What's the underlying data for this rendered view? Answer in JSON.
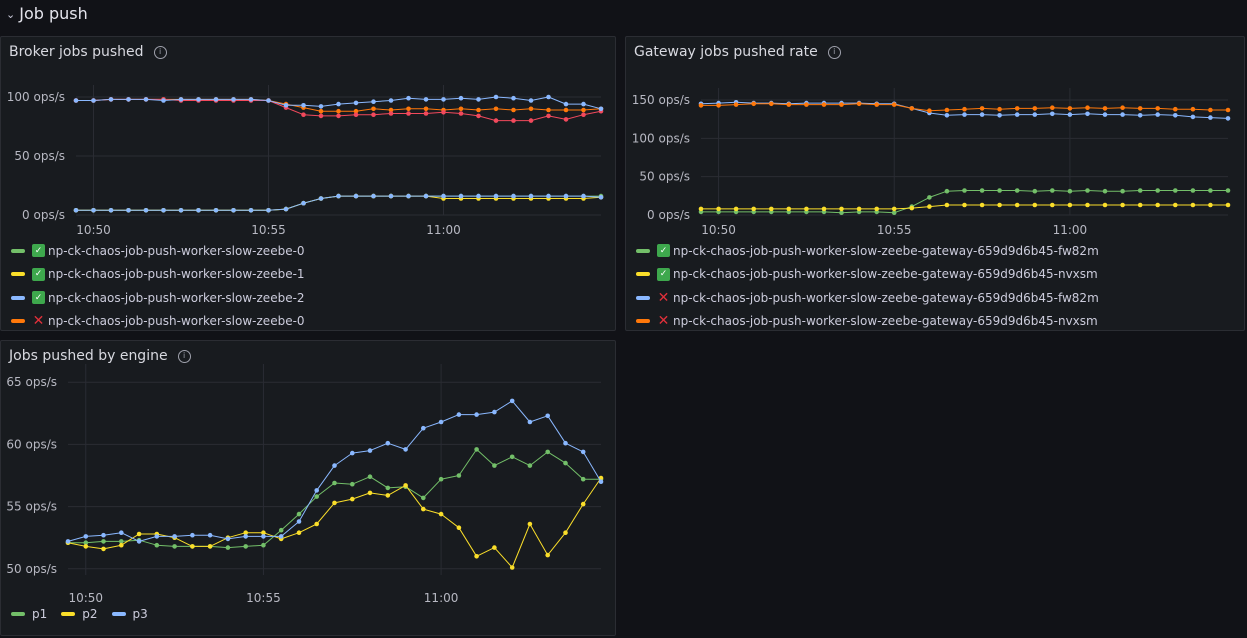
{
  "row": {
    "title": "Job push"
  },
  "panels": {
    "broker": {
      "title": "Broker jobs pushed",
      "legend": [
        {
          "status": "ok",
          "label": "np-ck-chaos-job-push-worker-slow-zeebe-0",
          "color": "#73bf69"
        },
        {
          "status": "ok",
          "label": "np-ck-chaos-job-push-worker-slow-zeebe-1",
          "color": "#fade2a"
        },
        {
          "status": "ok",
          "label": "np-ck-chaos-job-push-worker-slow-zeebe-2",
          "color": "#8ab8ff"
        },
        {
          "status": "bad",
          "label": "np-ck-chaos-job-push-worker-slow-zeebe-0",
          "color": "#ff780a"
        }
      ]
    },
    "gateway": {
      "title": "Gateway jobs pushed rate",
      "legend": [
        {
          "status": "ok",
          "label": "np-ck-chaos-job-push-worker-slow-zeebe-gateway-659d9d6b45-fw82m",
          "color": "#73bf69"
        },
        {
          "status": "ok",
          "label": "np-ck-chaos-job-push-worker-slow-zeebe-gateway-659d9d6b45-nvxsm",
          "color": "#fade2a"
        },
        {
          "status": "bad",
          "label": "np-ck-chaos-job-push-worker-slow-zeebe-gateway-659d9d6b45-fw82m",
          "color": "#8ab8ff"
        },
        {
          "status": "bad",
          "label": "np-ck-chaos-job-push-worker-slow-zeebe-gateway-659d9d6b45-nvxsm",
          "color": "#ff780a"
        }
      ]
    },
    "engine": {
      "title": "Jobs pushed by engine",
      "legend": [
        {
          "label": "p1",
          "color": "#73bf69"
        },
        {
          "label": "p2",
          "color": "#fade2a"
        },
        {
          "label": "p3",
          "color": "#8ab8ff"
        }
      ]
    }
  },
  "chart_data": [
    {
      "id": "broker",
      "type": "line",
      "title": "Broker jobs pushed",
      "unit": "ops/s",
      "xlabel": "",
      "ylabel": "",
      "x_ticks": [
        "10:50",
        "10:55",
        "11:00"
      ],
      "y_ticks": [
        "0 ops/s",
        "50 ops/s",
        "100 ops/s"
      ],
      "ylim": [
        0,
        100
      ],
      "grid": true,
      "legend_position": "bottom",
      "x": [
        "10:49:30",
        "10:50",
        "10:50:30",
        "10:51",
        "10:51:30",
        "10:52",
        "10:52:30",
        "10:53",
        "10:53:30",
        "10:54",
        "10:54:30",
        "10:55",
        "10:55:30",
        "10:56",
        "10:56:30",
        "10:57",
        "10:57:30",
        "10:58",
        "10:58:30",
        "10:59",
        "10:59:30",
        "11:00",
        "11:00:30",
        "11:01",
        "11:01:30",
        "11:02",
        "11:02:30",
        "11:03",
        "11:03:30",
        "11:04",
        "11:04:30"
      ],
      "series": [
        {
          "name": "np-ck-chaos-job-push-worker-slow-zeebe-0",
          "color": "#73bf69",
          "values": [
            4,
            4,
            4,
            4,
            4,
            4,
            4,
            4,
            4,
            4,
            4,
            4,
            5,
            10,
            14,
            16,
            16,
            16,
            16,
            16,
            16,
            16,
            16,
            16,
            16,
            16,
            16,
            16,
            16,
            16,
            16
          ]
        },
        {
          "name": "np-ck-chaos-job-push-worker-slow-zeebe-1",
          "color": "#fade2a",
          "values": [
            4,
            4,
            4,
            4,
            4,
            4,
            4,
            4,
            4,
            4,
            4,
            4,
            5,
            10,
            14,
            16,
            16,
            16,
            16,
            16,
            16,
            14,
            14,
            14,
            14,
            14,
            14,
            14,
            14,
            14,
            15
          ]
        },
        {
          "name": "np-ck-chaos-job-push-worker-slow-zeebe-2",
          "color": "#8ab8ff",
          "values": [
            4,
            4,
            4,
            4,
            4,
            4,
            4,
            4,
            4,
            4,
            4,
            4,
            5,
            10,
            14,
            16,
            16,
            16,
            16,
            16,
            16,
            16,
            16,
            16,
            16,
            16,
            16,
            16,
            16,
            16,
            15
          ]
        },
        {
          "name": "np-ck-chaos-job-push-worker-slow-zeebe-0",
          "color": "#ff780a",
          "values": [
            97,
            97,
            98,
            98,
            98,
            98,
            98,
            98,
            98,
            98,
            98,
            97,
            94,
            91,
            88,
            88,
            88,
            90,
            89,
            90,
            90,
            89,
            90,
            89,
            90,
            89,
            90,
            89,
            89,
            89,
            90
          ]
        },
        {
          "name": "",
          "color": "#f2495c",
          "values": [
            97,
            97,
            98,
            98,
            98,
            98,
            97,
            97,
            97,
            97,
            97,
            97,
            91,
            85,
            84,
            84,
            85,
            85,
            86,
            86,
            86,
            87,
            86,
            84,
            80,
            80,
            80,
            84,
            81,
            85,
            88
          ]
        },
        {
          "name": "",
          "color": "#8ab8ff",
          "values": [
            97,
            97,
            98,
            98,
            98,
            97,
            98,
            98,
            98,
            98,
            98,
            97,
            93,
            93,
            92,
            94,
            95,
            96,
            97,
            99,
            98,
            98,
            99,
            98,
            100,
            99,
            97,
            100,
            94,
            94,
            90
          ]
        }
      ]
    },
    {
      "id": "gateway",
      "type": "line",
      "title": "Gateway jobs pushed rate",
      "unit": "ops/s",
      "xlabel": "",
      "ylabel": "",
      "x_ticks": [
        "10:50",
        "10:55",
        "11:00"
      ],
      "y_ticks": [
        "0 ops/s",
        "50 ops/s",
        "100 ops/s",
        "150 ops/s"
      ],
      "ylim": [
        0,
        150
      ],
      "grid": true,
      "legend_position": "bottom",
      "x": [
        "10:49:30",
        "10:50",
        "10:50:30",
        "10:51",
        "10:51:30",
        "10:52",
        "10:52:30",
        "10:53",
        "10:53:30",
        "10:54",
        "10:54:30",
        "10:55",
        "10:55:30",
        "10:56",
        "10:56:30",
        "10:57",
        "10:57:30",
        "10:58",
        "10:58:30",
        "10:59",
        "10:59:30",
        "11:00",
        "11:00:30",
        "11:01",
        "11:01:30",
        "11:02",
        "11:02:30",
        "11:03",
        "11:03:30",
        "11:04",
        "11:04:30"
      ],
      "series": [
        {
          "name": "np-ck-chaos-job-push-worker-slow-zeebe-gateway-659d9d6b45-fw82m",
          "color": "#73bf69",
          "values": [
            4,
            4,
            4,
            4,
            4,
            4,
            4,
            4,
            3,
            4,
            4,
            3,
            11,
            23,
            31,
            32,
            32,
            32,
            32,
            31,
            32,
            31,
            32,
            31,
            31,
            32,
            32,
            32,
            32,
            32,
            32
          ]
        },
        {
          "name": "np-ck-chaos-job-push-worker-slow-zeebe-gateway-659d9d6b45-nvxsm",
          "color": "#fade2a",
          "values": [
            8,
            8,
            8,
            8,
            8,
            8,
            8,
            8,
            8,
            8,
            8,
            8,
            9,
            11,
            13,
            13,
            13,
            13,
            13,
            13,
            13,
            13,
            13,
            13,
            13,
            13,
            13,
            13,
            13,
            13,
            13
          ]
        },
        {
          "name": "np-ck-chaos-job-push-worker-slow-zeebe-gateway-659d9d6b45-fw82m",
          "color": "#8ab8ff",
          "values": [
            145,
            146,
            147,
            146,
            146,
            145,
            146,
            146,
            146,
            146,
            145,
            145,
            139,
            133,
            130,
            131,
            131,
            130,
            131,
            131,
            132,
            131,
            132,
            131,
            131,
            130,
            131,
            130,
            128,
            127,
            126
          ]
        },
        {
          "name": "np-ck-chaos-job-push-worker-slow-zeebe-gateway-659d9d6b45-nvxsm",
          "color": "#ff780a",
          "values": [
            143,
            143,
            144,
            145,
            145,
            144,
            144,
            144,
            144,
            145,
            144,
            144,
            139,
            136,
            137,
            138,
            139,
            138,
            139,
            139,
            140,
            139,
            140,
            139,
            140,
            139,
            139,
            138,
            138,
            137,
            137
          ]
        }
      ]
    },
    {
      "id": "engine",
      "type": "line",
      "title": "Jobs pushed by engine",
      "unit": "ops/s",
      "xlabel": "",
      "ylabel": "",
      "x_ticks": [
        "10:50",
        "10:55",
        "11:00"
      ],
      "y_ticks": [
        "50 ops/s",
        "55 ops/s",
        "60 ops/s",
        "65 ops/s"
      ],
      "ylim": [
        49.5,
        65.5
      ],
      "grid": true,
      "legend_position": "bottom",
      "x": [
        "10:49:30",
        "10:50",
        "10:50:30",
        "10:51",
        "10:51:30",
        "10:52",
        "10:52:30",
        "10:53",
        "10:53:30",
        "10:54",
        "10:54:30",
        "10:55",
        "10:55:30",
        "10:56",
        "10:56:30",
        "10:57",
        "10:57:30",
        "10:58",
        "10:58:30",
        "10:59",
        "10:59:30",
        "11:00",
        "11:00:30",
        "11:01",
        "11:01:30",
        "11:02",
        "11:02:30",
        "11:03",
        "11:03:30",
        "11:04",
        "11:04:30"
      ],
      "series": [
        {
          "name": "p1",
          "color": "#73bf69",
          "values": [
            52.1,
            52.1,
            52.2,
            52.2,
            52.3,
            51.9,
            51.8,
            51.8,
            51.8,
            51.7,
            51.8,
            51.9,
            53.1,
            54.4,
            55.8,
            56.9,
            56.8,
            57.4,
            56.5,
            56.6,
            55.7,
            57.2,
            57.5,
            59.6,
            58.3,
            59,
            58.3,
            59.4,
            58.5,
            57.2,
            57.2
          ]
        },
        {
          "name": "p2",
          "color": "#fade2a",
          "values": [
            52.1,
            51.8,
            51.6,
            51.9,
            52.8,
            52.8,
            52.5,
            51.8,
            51.8,
            52.5,
            52.9,
            52.9,
            52.4,
            52.9,
            53.6,
            55.3,
            55.6,
            56.1,
            55.9,
            56.7,
            54.8,
            54.4,
            53.3,
            51,
            51.7,
            50.1,
            53.6,
            51.1,
            52.9,
            55.2,
            57.3
          ]
        },
        {
          "name": "p3",
          "color": "#8ab8ff",
          "values": [
            52.2,
            52.6,
            52.7,
            52.9,
            52.2,
            52.6,
            52.6,
            52.7,
            52.7,
            52.4,
            52.6,
            52.6,
            52.6,
            53.8,
            56.3,
            58.3,
            59.3,
            59.5,
            60.1,
            59.6,
            61.3,
            61.8,
            62.4,
            62.4,
            62.6,
            63.5,
            61.8,
            62.3,
            60.1,
            59.4,
            57
          ]
        }
      ]
    }
  ]
}
